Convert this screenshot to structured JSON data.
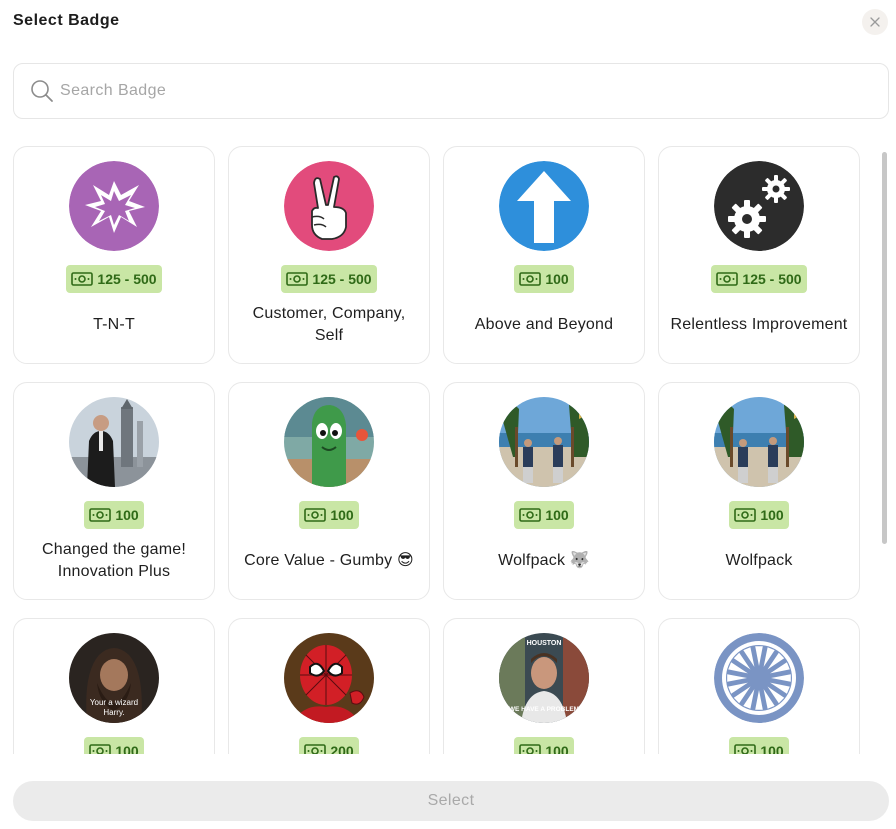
{
  "modal": {
    "title": "Select Badge",
    "close_icon": "close-icon"
  },
  "search": {
    "placeholder": "Search Badge",
    "value": "",
    "icon": "search-icon"
  },
  "badges": [
    {
      "name": "T-N-T",
      "points": "125 - 500",
      "image": "explosion-star-icon",
      "color": "#a865b5"
    },
    {
      "name": "Customer, Company, Self",
      "points": "125 - 500",
      "image": "peace-hand-icon",
      "color": "#e24b7c"
    },
    {
      "name": "Above and Beyond",
      "points": "100",
      "image": "arrow-up-icon",
      "color": "#2e8fdb"
    },
    {
      "name": "Relentless Improvement",
      "points": "125 - 500",
      "image": "gears-icon",
      "color": "#2c2c2c"
    },
    {
      "name": "Changed the game! Innovation Plus",
      "points": "100",
      "image": "person-rocket-photo"
    },
    {
      "name": "Core Value - Gumby 😎",
      "points": "100",
      "image": "gumby-photo"
    },
    {
      "name": "Wolfpack 🐺",
      "points": "100",
      "image": "beach-group-photo"
    },
    {
      "name": "Wolfpack",
      "points": "100",
      "image": "beach-group-photo"
    },
    {
      "name": "",
      "points": "100",
      "image": "wizard-meme-photo",
      "caption": "Your a wizard Harry."
    },
    {
      "name": "",
      "points": "200",
      "image": "spiderman-photo"
    },
    {
      "name": "",
      "points": "100",
      "image": "houston-meme-photo",
      "caption_top": "HOUSTON",
      "caption_bottom": "WE HAVE A PROBLEM"
    },
    {
      "name": "",
      "points": "100",
      "image": "ship-wheel-icon",
      "color": "#7a94c4"
    }
  ],
  "footer": {
    "select_label": "Select"
  },
  "colors": {
    "points_bg": "#c9e6a5",
    "points_text": "#2f6a17",
    "select_bg": "#ebebeb"
  }
}
